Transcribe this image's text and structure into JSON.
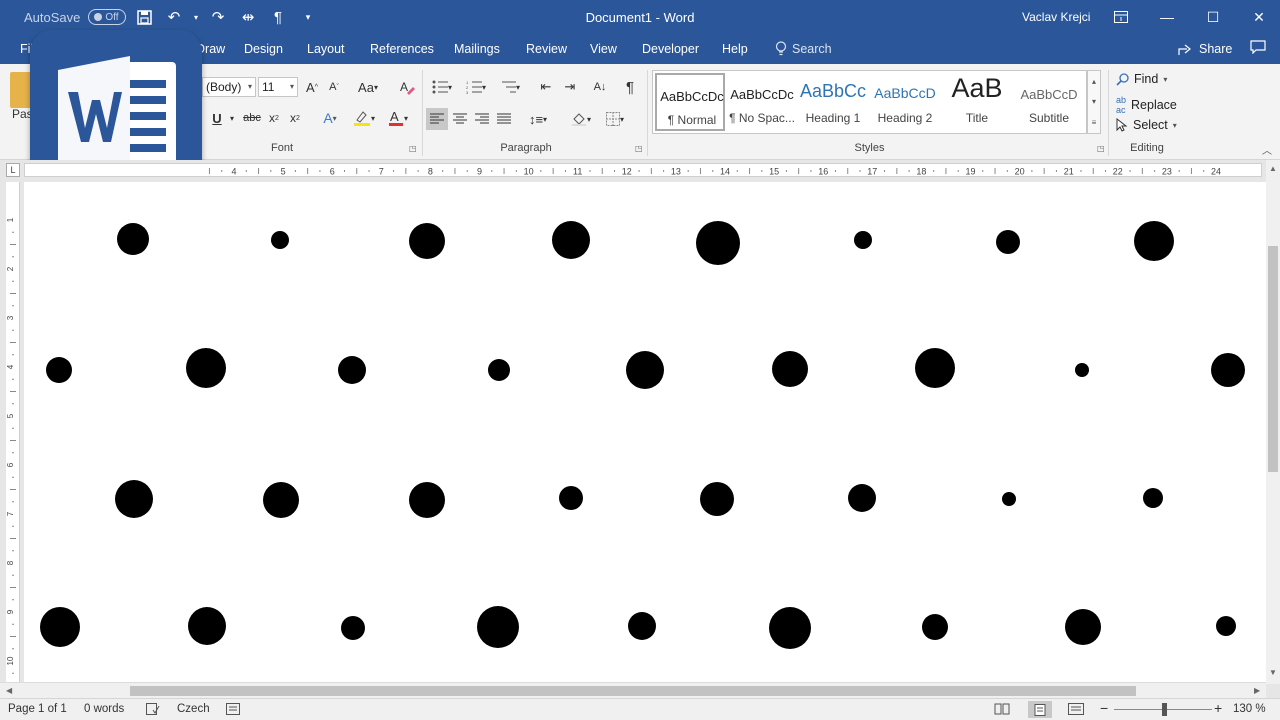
{
  "titlebar": {
    "autosave_label": "AutoSave",
    "autosave_state": "Off",
    "document_title": "Document1  -  Word",
    "user_name": "Vaclav Krejci"
  },
  "tabs": [
    {
      "label": "File"
    },
    {
      "label": "Draw"
    },
    {
      "label": "Design"
    },
    {
      "label": "Layout"
    },
    {
      "label": "References"
    },
    {
      "label": "Mailings"
    },
    {
      "label": "Review"
    },
    {
      "label": "View"
    },
    {
      "label": "Developer"
    },
    {
      "label": "Help"
    }
  ],
  "tab_search_label": "Search",
  "share_label": "Share",
  "ribbon": {
    "paste_label": "Paste",
    "font_name": "(Body)",
    "font_size": "11",
    "font_group": "Font",
    "paragraph_group": "Paragraph",
    "styles_group": "Styles",
    "editing_group": "Editing",
    "styles": [
      {
        "preview": "AaBbCcDc",
        "name": "¶ Normal"
      },
      {
        "preview": "AaBbCcDc",
        "name": "¶ No Spac..."
      },
      {
        "preview": "AaBbCc",
        "name": "Heading 1"
      },
      {
        "preview": "AaBbCcD",
        "name": "Heading 2"
      },
      {
        "preview": "AaB",
        "name": "Title"
      },
      {
        "preview": "AaBbCcD",
        "name": "Subtitle"
      }
    ],
    "find_label": "Find",
    "replace_label": "Replace",
    "select_label": "Select"
  },
  "ruler": {
    "h_labels": [
      "4",
      "5",
      "6",
      "7",
      "8",
      "9",
      "10",
      "11",
      "12",
      "13",
      "14",
      "15",
      "16",
      "17",
      "18",
      "19",
      "20",
      "21",
      "22",
      "23",
      "24"
    ],
    "v_labels": [
      "1",
      "2",
      "3",
      "4",
      "5",
      "6",
      "7",
      "8",
      "9",
      "10"
    ]
  },
  "statusbar": {
    "page": "Page 1 of 1",
    "words": "0 words",
    "language": "Czech",
    "zoom": "130 %"
  },
  "colors": {
    "accent": "#2b579a",
    "dots": "#000000"
  }
}
